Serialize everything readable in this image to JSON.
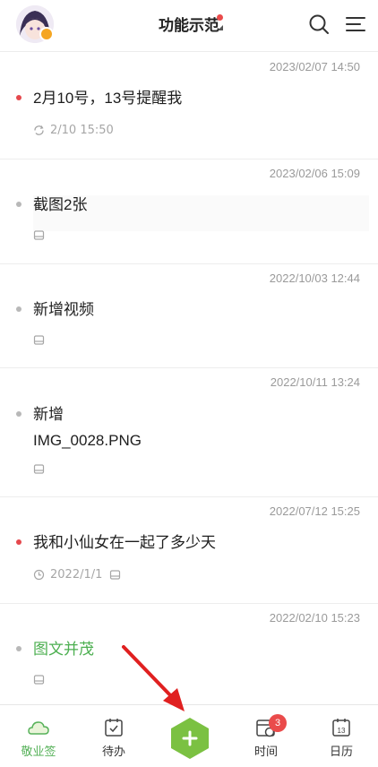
{
  "header": {
    "title": "功能示范",
    "avatar": "avatar",
    "icons": [
      "search-icon",
      "menu-icon"
    ]
  },
  "notes": [
    {
      "timestamp": "2023/02/07 14:50",
      "title": "2月10号，13号提醒我",
      "bullet": "red",
      "meta_icon": "repeat-reminder-icon",
      "meta_text": "2/10 15:50"
    },
    {
      "timestamp": "2023/02/06 15:09",
      "title": "截图2张",
      "bullet": "gray",
      "meta_icon": "attachment-icon",
      "meta_text": ""
    },
    {
      "timestamp": "2022/10/03 12:44",
      "title": "新增视频",
      "bullet": "gray",
      "meta_icon": "attachment-icon",
      "meta_text": ""
    },
    {
      "timestamp": "2022/10/11 13:24",
      "title_lines": [
        "新增",
        "IMG_0028.PNG"
      ],
      "bullet": "gray",
      "meta_icon": "attachment-icon",
      "meta_text": ""
    },
    {
      "timestamp": "2022/07/12 15:25",
      "title": "我和小仙女在一起了多少天",
      "bullet": "red",
      "meta_icon": "clock-icon",
      "meta_text": "2022/1/1"
    },
    {
      "timestamp": "2022/02/10 15:23",
      "title": "图文并茂",
      "bullet": "gray",
      "title_color": "#4caf50",
      "meta_icon": "attachment-icon",
      "meta_text": ""
    }
  ],
  "bottom_nav": {
    "tabs": [
      {
        "label": "敬业签",
        "icon": "cloud-icon",
        "active": true
      },
      {
        "label": "待办",
        "icon": "todo-check-icon",
        "active": false
      },
      {
        "label": "时间",
        "icon": "time-calendar-icon",
        "badge": "3",
        "active": false
      },
      {
        "label": "日历",
        "icon": "calendar-icon",
        "day": "13",
        "active": false
      }
    ],
    "add_button": "add-icon"
  },
  "colors": {
    "accent_green": "#57b25a",
    "badge_red": "#ea4b4b",
    "fab_green": "#7bc142",
    "arrow_red": "#e02020"
  }
}
